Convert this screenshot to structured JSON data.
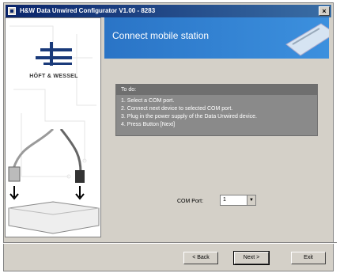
{
  "window": {
    "title": "H&W Data Unwired Configurator V1.00 - 8283"
  },
  "sidebar": {
    "brand": "HÖFT & WESSEL"
  },
  "banner": {
    "title": "Connect mobile station"
  },
  "todo": {
    "heading": "To do:",
    "steps": [
      "1. Select a COM port.",
      "2. Connect next device to selected COM port.",
      "3. Plug in the power supply of the Data Unwired device.",
      "4. Press Button [Next]"
    ]
  },
  "com": {
    "label": "COM Port:",
    "value": "1"
  },
  "buttons": {
    "back": "< Back",
    "next": "Next >",
    "exit": "Exit"
  },
  "colors": {
    "title_bar": "#0a246a",
    "banner": "#2a74c6",
    "panel": "#d4d0c8",
    "todo_bg": "#8a8a8a"
  }
}
